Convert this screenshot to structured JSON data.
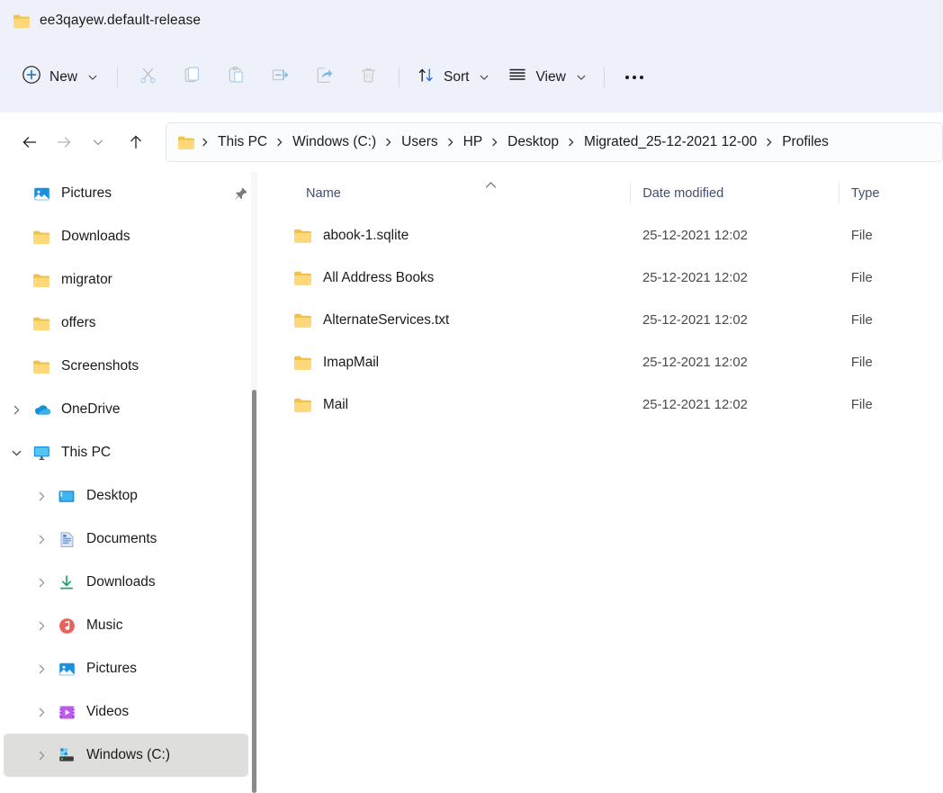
{
  "window": {
    "title": "ee3qayew.default-release",
    "title_icon": "folder-icon"
  },
  "toolbar": {
    "new_label": "New",
    "new_icon": "plus-circle-icon",
    "new_chevron_icon": "chevron-down-icon",
    "cut_icon": "scissors-icon",
    "copy_icon": "copy-icon",
    "paste_icon": "clipboard-icon",
    "rename_icon": "rename-icon",
    "share_icon": "share-icon",
    "delete_icon": "trash-icon",
    "sort_label": "Sort",
    "sort_icon": "sort-arrows-icon",
    "sort_chevron_icon": "chevron-down-icon",
    "view_label": "View",
    "view_icon": "view-lines-icon",
    "view_chevron_icon": "chevron-down-icon",
    "more_label": "See more",
    "more_icon": "ellipsis-icon",
    "accent_color": "#0f6cbd",
    "disabled_color": "#bcd8f0"
  },
  "navigation": {
    "back_icon": "arrow-left-icon",
    "forward_icon": "arrow-right-icon",
    "recent_icon": "chevron-down-icon",
    "up_icon": "arrow-up-icon",
    "address_icon": "folder-icon",
    "breadcrumbs": [
      "This PC",
      "Windows (C:)",
      "Users",
      "HP",
      "Desktop",
      "Migrated_25-12-2021 12-00",
      "Profiles"
    ],
    "separator": "›"
  },
  "sidebar": {
    "scroll_thumb_top_pct": 35,
    "scroll_thumb_height_pct": 65,
    "items": [
      {
        "label": "Pictures",
        "icon": "pictures-icon",
        "expander": "none",
        "indent": 1,
        "pinned": true,
        "selected": false
      },
      {
        "label": "Downloads",
        "icon": "folder-icon",
        "expander": "none",
        "indent": 1,
        "pinned": false,
        "selected": false
      },
      {
        "label": "migrator",
        "icon": "folder-icon",
        "expander": "none",
        "indent": 1,
        "pinned": false,
        "selected": false
      },
      {
        "label": "offers",
        "icon": "folder-icon",
        "expander": "none",
        "indent": 1,
        "pinned": false,
        "selected": false
      },
      {
        "label": "Screenshots",
        "icon": "folder-icon",
        "expander": "none",
        "indent": 1,
        "pinned": false,
        "selected": false
      },
      {
        "label": "OneDrive",
        "icon": "onedrive-icon",
        "expander": "collapsed",
        "indent": 0,
        "pinned": false,
        "selected": false
      },
      {
        "label": "This PC",
        "icon": "thispc-icon",
        "expander": "expanded",
        "indent": 0,
        "pinned": false,
        "selected": false
      },
      {
        "label": "Desktop",
        "icon": "desktop-icon",
        "expander": "collapsed",
        "indent": 1,
        "pinned": false,
        "selected": false
      },
      {
        "label": "Documents",
        "icon": "documents-icon",
        "expander": "collapsed",
        "indent": 1,
        "pinned": false,
        "selected": false
      },
      {
        "label": "Downloads",
        "icon": "download-icon",
        "expander": "collapsed",
        "indent": 1,
        "pinned": false,
        "selected": false
      },
      {
        "label": "Music",
        "icon": "music-icon",
        "expander": "collapsed",
        "indent": 1,
        "pinned": false,
        "selected": false
      },
      {
        "label": "Pictures",
        "icon": "pictures-icon",
        "expander": "collapsed",
        "indent": 1,
        "pinned": false,
        "selected": false
      },
      {
        "label": "Videos",
        "icon": "videos-icon",
        "expander": "collapsed",
        "indent": 1,
        "pinned": false,
        "selected": false
      },
      {
        "label": "Windows (C:)",
        "icon": "drive-icon",
        "expander": "collapsed",
        "indent": 1,
        "pinned": false,
        "selected": true
      }
    ]
  },
  "filelist": {
    "columns": [
      {
        "key": "name",
        "label": "Name",
        "sorted": "asc"
      },
      {
        "key": "date",
        "label": "Date modified",
        "sorted": "none"
      },
      {
        "key": "type",
        "label": "Type",
        "sorted": "none"
      }
    ],
    "sort_caret_icon": "chevron-up-icon",
    "rows": [
      {
        "name": "abook-1.sqlite",
        "date": "25-12-2021 12:02",
        "type": "File",
        "icon": "folder-icon"
      },
      {
        "name": "All Address Books",
        "date": "25-12-2021 12:02",
        "type": "File",
        "icon": "folder-icon"
      },
      {
        "name": "AlternateServices.txt",
        "date": "25-12-2021 12:02",
        "type": "File",
        "icon": "folder-icon"
      },
      {
        "name": "ImapMail",
        "date": "25-12-2021 12:02",
        "type": "File",
        "icon": "folder-icon"
      },
      {
        "name": "Mail",
        "date": "25-12-2021 12:02",
        "type": "File",
        "icon": "folder-icon"
      }
    ]
  }
}
